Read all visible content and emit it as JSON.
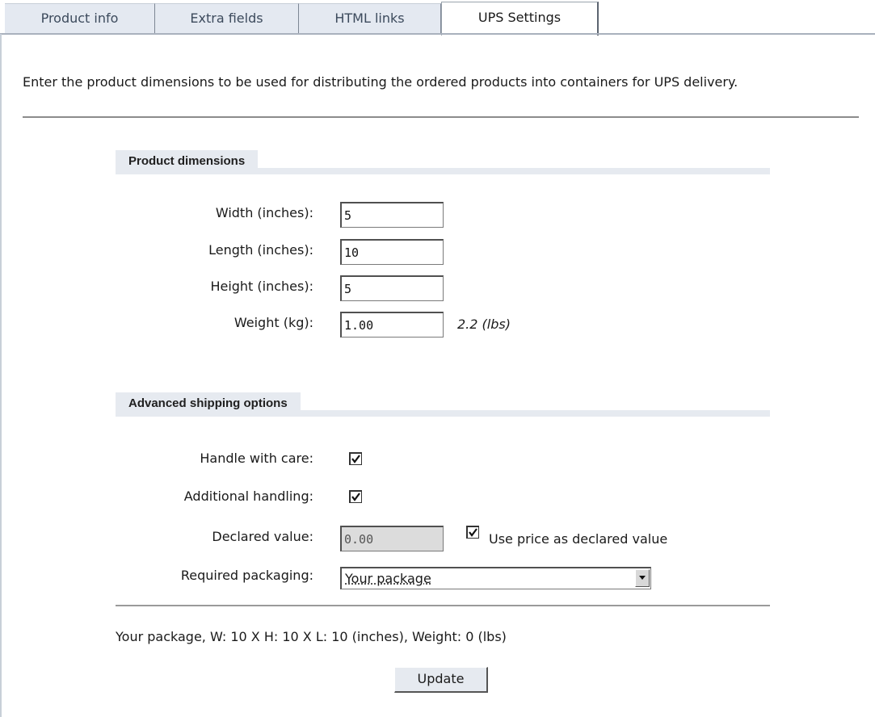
{
  "tabs": [
    {
      "label": "Product info"
    },
    {
      "label": "Extra fields"
    },
    {
      "label": "HTML links"
    },
    {
      "label": "UPS Settings",
      "active": true
    }
  ],
  "intro": "Enter the product dimensions to be used for distributing the ordered products into containers for UPS delivery.",
  "dimensions": {
    "heading": "Product dimensions",
    "width_label": "Width (inches):",
    "width_value": "5",
    "length_label": "Length (inches):",
    "length_value": "10",
    "height_label": "Height (inches):",
    "height_value": "5",
    "weight_label": "Weight (kg):",
    "weight_value": "1.00",
    "weight_lbs": "2.2",
    "weight_lbs_unit": "(lbs)"
  },
  "advanced": {
    "heading": "Advanced shipping options",
    "care_label": "Handle with care:",
    "care_checked": true,
    "handling_label": "Additional handling:",
    "handling_checked": true,
    "declared_label": "Declared value:",
    "declared_value": "0.00",
    "use_price_label": "Use price as declared value",
    "use_price_checked": true,
    "packaging_label": "Required packaging:",
    "packaging_selected": "Your package"
  },
  "summary": "Your package, W: 10 X H: 10 X L: 10 (inches), Weight: 0 (lbs)",
  "update_label": "Update",
  "colors": {
    "tab_bg": "#e4e9f1",
    "section_bg": "#e6eaf0",
    "rule": "#8c8c8c"
  }
}
